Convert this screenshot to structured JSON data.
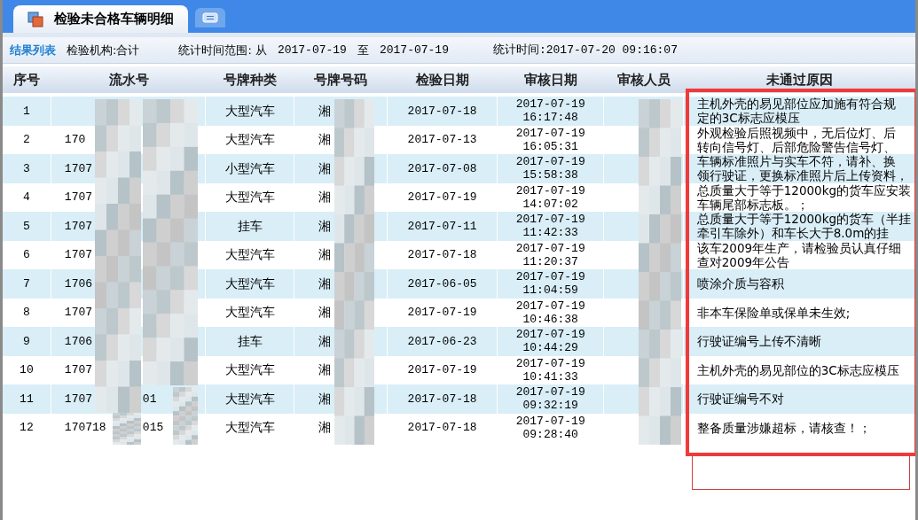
{
  "tabs": [
    {
      "label": "检验未合格车辆明细",
      "selected": true,
      "kind": "labeled"
    },
    {
      "kind": "icon",
      "selected": false
    }
  ],
  "toolbar": {
    "title": "结果列表",
    "agency": "检验机构:合计",
    "range_label": "统计时间范围: 从",
    "range_from": "2017-07-19",
    "range_sep": "至",
    "range_to": "2017-07-19",
    "stat_time": "统计时间:2017-07-20 09:16:07"
  },
  "table": {
    "columns": [
      "序号",
      "流水号",
      "号牌种类",
      "号牌号码",
      "检验日期",
      "审核日期",
      "审核人员",
      "未通过原因"
    ],
    "rows": [
      {
        "no": "1",
        "serial": [],
        "plate_type": "大型汽车",
        "plate": "湘",
        "inspect_date": "2017-07-18",
        "review_date": "2017-07-19",
        "review_time": "16:17:48",
        "reason": [
          "主机外壳的易见部位应加施有符合规",
          "定的3C标志应模压"
        ]
      },
      {
        "no": "2",
        "serial": [
          "170"
        ],
        "plate_type": "大型汽车",
        "plate": "湘",
        "inspect_date": "2017-07-13",
        "review_date": "2017-07-19",
        "review_time": "16:05:31",
        "reason": [
          "外观检验后照视频中，无后位灯、后",
          "转向信号灯、后部危险警告信号灯、"
        ]
      },
      {
        "no": "3",
        "serial": [
          "1707"
        ],
        "plate_type": "小型汽车",
        "plate": "湘",
        "inspect_date": "2017-07-08",
        "review_date": "2017-07-19",
        "review_time": "15:58:38",
        "reason": [
          "车辆标准照片与实车不符，请补、换",
          "领行驶证，更换标准照片后上传资料，"
        ]
      },
      {
        "no": "4",
        "serial": [
          "1707"
        ],
        "plate_type": "大型汽车",
        "plate": "湘",
        "inspect_date": "2017-07-19",
        "review_date": "2017-07-19",
        "review_time": "14:07:02",
        "reason": [
          "总质量大于等于12000kg的货车应安装",
          "车辆尾部标志板。；"
        ]
      },
      {
        "no": "5",
        "serial": [
          "1707"
        ],
        "plate_type": "挂车",
        "plate": "湘",
        "inspect_date": "2017-07-11",
        "review_date": "2017-07-19",
        "review_time": "11:42:33",
        "reason": [
          "总质量大于等于12000kg的货车（半挂",
          "牵引车除外）和车长大于8.0m的挂"
        ]
      },
      {
        "no": "6",
        "serial": [
          "1707"
        ],
        "plate_type": "大型汽车",
        "plate": "湘",
        "inspect_date": "2017-07-18",
        "review_date": "2017-07-19",
        "review_time": "11:20:37",
        "reason": [
          "该车2009年生产，请检验员认真仔细",
          "查对2009年公告"
        ]
      },
      {
        "no": "7",
        "serial": [
          "1706"
        ],
        "plate_type": "大型汽车",
        "plate": "湘",
        "inspect_date": "2017-06-05",
        "review_date": "2017-07-19",
        "review_time": "11:04:59",
        "reason": [
          "喷涂介质与容积"
        ]
      },
      {
        "no": "8",
        "serial": [
          "1707"
        ],
        "plate_type": "大型汽车",
        "plate": "湘",
        "inspect_date": "2017-07-19",
        "review_date": "2017-07-19",
        "review_time": "10:46:38",
        "reason": [
          "非本车保险单或保单未生效;"
        ]
      },
      {
        "no": "9",
        "serial": [
          "1706"
        ],
        "plate_type": "挂车",
        "plate": "湘",
        "inspect_date": "2017-06-23",
        "review_date": "2017-07-19",
        "review_time": "10:44:29",
        "reason": [
          "行驶证编号上传不清晰"
        ]
      },
      {
        "no": "10",
        "serial": [
          "1707"
        ],
        "plate_type": "大型汽车",
        "plate": "湘",
        "inspect_date": "2017-07-19",
        "review_date": "2017-07-19",
        "review_time": "10:41:33",
        "reason": [
          "主机外壳的易见部位的3C标志应模压"
        ]
      },
      {
        "no": "11",
        "serial": [
          "1707",
          "01"
        ],
        "plate_type": "大型汽车",
        "plate": "湘",
        "inspect_date": "2017-07-18",
        "review_date": "2017-07-19",
        "review_time": "09:32:19",
        "reason": [
          "行驶证编号不对"
        ]
      },
      {
        "no": "12",
        "serial": [
          "170718",
          "015"
        ],
        "plate_type": "大型汽车",
        "plate": "湘",
        "inspect_date": "2017-07-18",
        "review_date": "2017-07-19",
        "review_time": "09:28:40",
        "reason": [
          "整备质量涉嫌超标，请核查！；"
        ]
      }
    ]
  }
}
